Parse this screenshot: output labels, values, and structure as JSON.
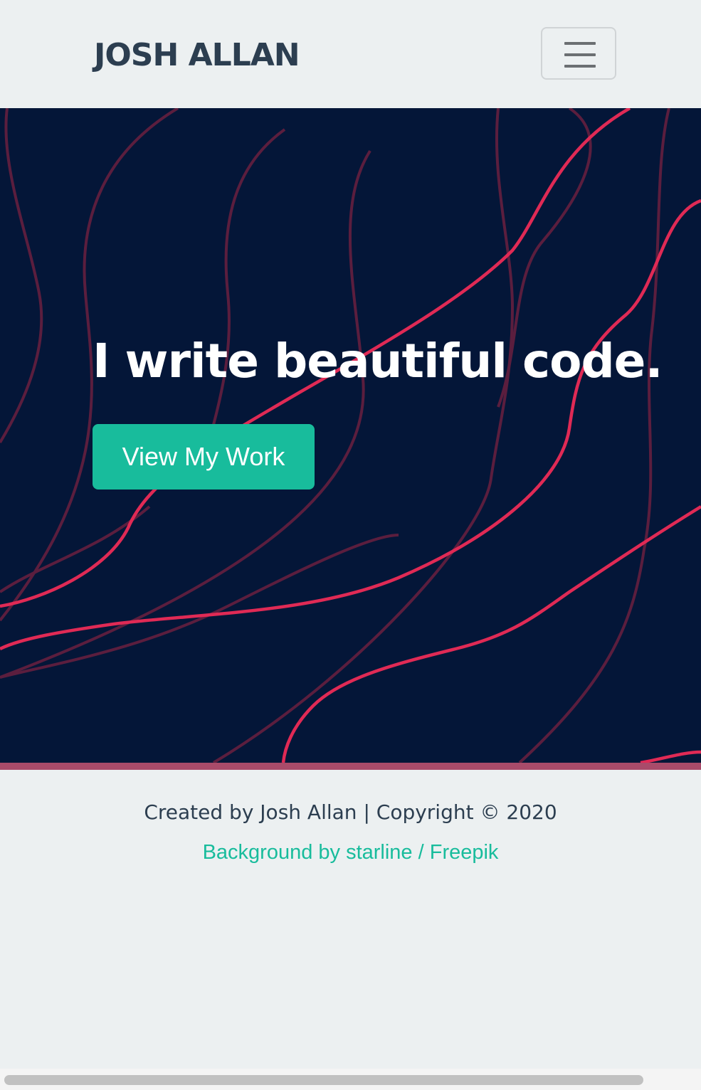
{
  "navbar": {
    "brand": "JOSH ALLAN",
    "menu_toggle_icon": "hamburger-icon"
  },
  "hero": {
    "headline": "I write beautiful code.",
    "cta_label": "View My Work",
    "background_color": "#041638",
    "line_color": "#e02a55"
  },
  "footer": {
    "credit": "Created by Josh Allan | Copyright © 2020",
    "background_credit": "Background by starline / Freepik"
  },
  "colors": {
    "accent": "#18bc9c",
    "text_dark": "#2c3e50",
    "page_bg": "#ecf0f1"
  }
}
